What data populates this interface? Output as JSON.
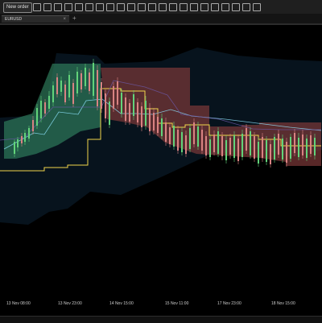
{
  "toolbar": {
    "new_order_label": "New order"
  },
  "tabs": [
    {
      "label": "EURUSD",
      "close": "×"
    }
  ],
  "tab_add": "+",
  "time_axis": [
    "13 Nov 08:00",
    "13 Nov 23:00",
    "14 Nov 15:00",
    "15 Nov 11:00",
    "17 Nov 23:00",
    "18 Nov 15:00"
  ],
  "colors": {
    "bg": "#000000",
    "cloud_blue": "#07131d",
    "green": "#2f7d5d",
    "red": "#7a3838",
    "yellow": "#f1d54c",
    "cyan": "#8ee5ff",
    "purple": "#6c57a5"
  }
}
